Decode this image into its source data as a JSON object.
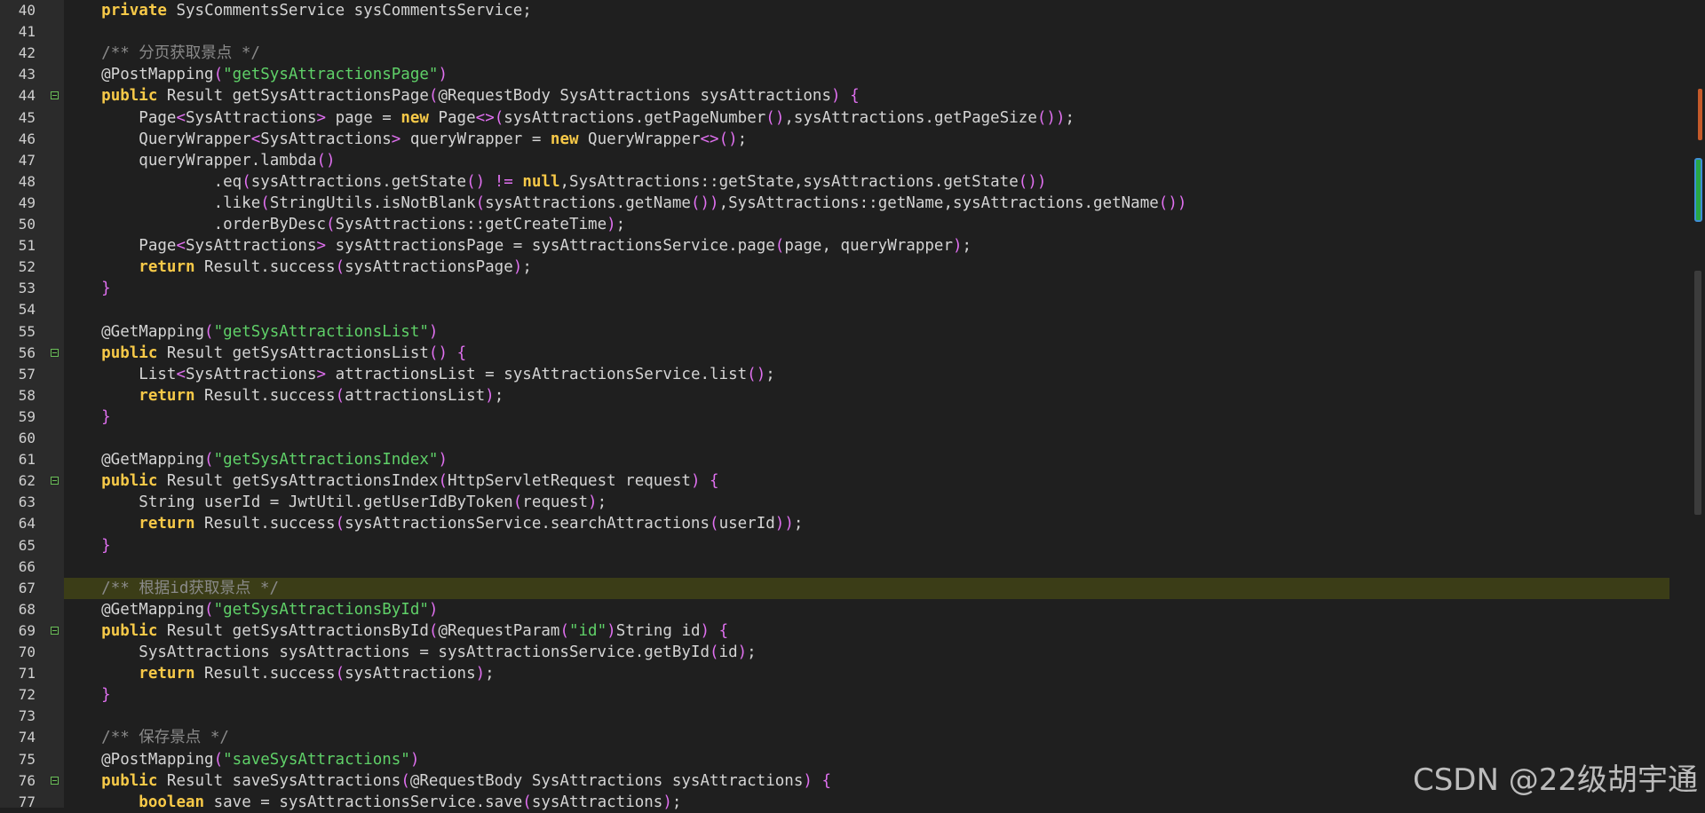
{
  "watermark": "CSDN @22级胡宇通",
  "lines": [
    {
      "n": "40",
      "t": "    private SysCommentsService sysCommentsService;"
    },
    {
      "n": "41",
      "t": ""
    },
    {
      "n": "42",
      "t": "    /** 分页获取景点 */"
    },
    {
      "n": "43",
      "t": "    @PostMapping(\"getSysAttractionsPage\")"
    },
    {
      "n": "44",
      "t": "    public Result getSysAttractionsPage(@RequestBody SysAttractions sysAttractions) {",
      "marker": true
    },
    {
      "n": "45",
      "t": "        Page<SysAttractions> page = new Page<>(sysAttractions.getPageNumber(),sysAttractions.getPageSize());"
    },
    {
      "n": "46",
      "t": "        QueryWrapper<SysAttractions> queryWrapper = new QueryWrapper<>();"
    },
    {
      "n": "47",
      "t": "        queryWrapper.lambda()"
    },
    {
      "n": "48",
      "t": "                .eq(sysAttractions.getState() != null,SysAttractions::getState,sysAttractions.getState())"
    },
    {
      "n": "49",
      "t": "                .like(StringUtils.isNotBlank(sysAttractions.getName()),SysAttractions::getName,sysAttractions.getName())"
    },
    {
      "n": "50",
      "t": "                .orderByDesc(SysAttractions::getCreateTime);"
    },
    {
      "n": "51",
      "t": "        Page<SysAttractions> sysAttractionsPage = sysAttractionsService.page(page, queryWrapper);"
    },
    {
      "n": "52",
      "t": "        return Result.success(sysAttractionsPage);"
    },
    {
      "n": "53",
      "t": "    }"
    },
    {
      "n": "54",
      "t": ""
    },
    {
      "n": "55",
      "t": "    @GetMapping(\"getSysAttractionsList\")"
    },
    {
      "n": "56",
      "t": "    public Result getSysAttractionsList() {",
      "marker": true
    },
    {
      "n": "57",
      "t": "        List<SysAttractions> attractionsList = sysAttractionsService.list();"
    },
    {
      "n": "58",
      "t": "        return Result.success(attractionsList);"
    },
    {
      "n": "59",
      "t": "    }"
    },
    {
      "n": "60",
      "t": ""
    },
    {
      "n": "61",
      "t": "    @GetMapping(\"getSysAttractionsIndex\")"
    },
    {
      "n": "62",
      "t": "    public Result getSysAttractionsIndex(HttpServletRequest request) {",
      "marker": true
    },
    {
      "n": "63",
      "t": "        String userId = JwtUtil.getUserIdByToken(request);"
    },
    {
      "n": "64",
      "t": "        return Result.success(sysAttractionsService.searchAttractions(userId));"
    },
    {
      "n": "65",
      "t": "    }"
    },
    {
      "n": "66",
      "t": ""
    },
    {
      "n": "67",
      "t": "    /** 根据id获取景点 */",
      "highlight": true
    },
    {
      "n": "68",
      "t": "    @GetMapping(\"getSysAttractionsById\")"
    },
    {
      "n": "69",
      "t": "    public Result getSysAttractionsById(@RequestParam(\"id\")String id) {",
      "marker": true
    },
    {
      "n": "70",
      "t": "        SysAttractions sysAttractions = sysAttractionsService.getById(id);"
    },
    {
      "n": "71",
      "t": "        return Result.success(sysAttractions);"
    },
    {
      "n": "72",
      "t": "    }"
    },
    {
      "n": "73",
      "t": ""
    },
    {
      "n": "74",
      "t": "    /** 保存景点 */"
    },
    {
      "n": "75",
      "t": "    @PostMapping(\"saveSysAttractions\")"
    },
    {
      "n": "76",
      "t": "    public Result saveSysAttractions(@RequestBody SysAttractions sysAttractions) {",
      "marker": true
    },
    {
      "n": "77",
      "t": "        boolean save = sysAttractionsService.save(sysAttractions);"
    }
  ]
}
